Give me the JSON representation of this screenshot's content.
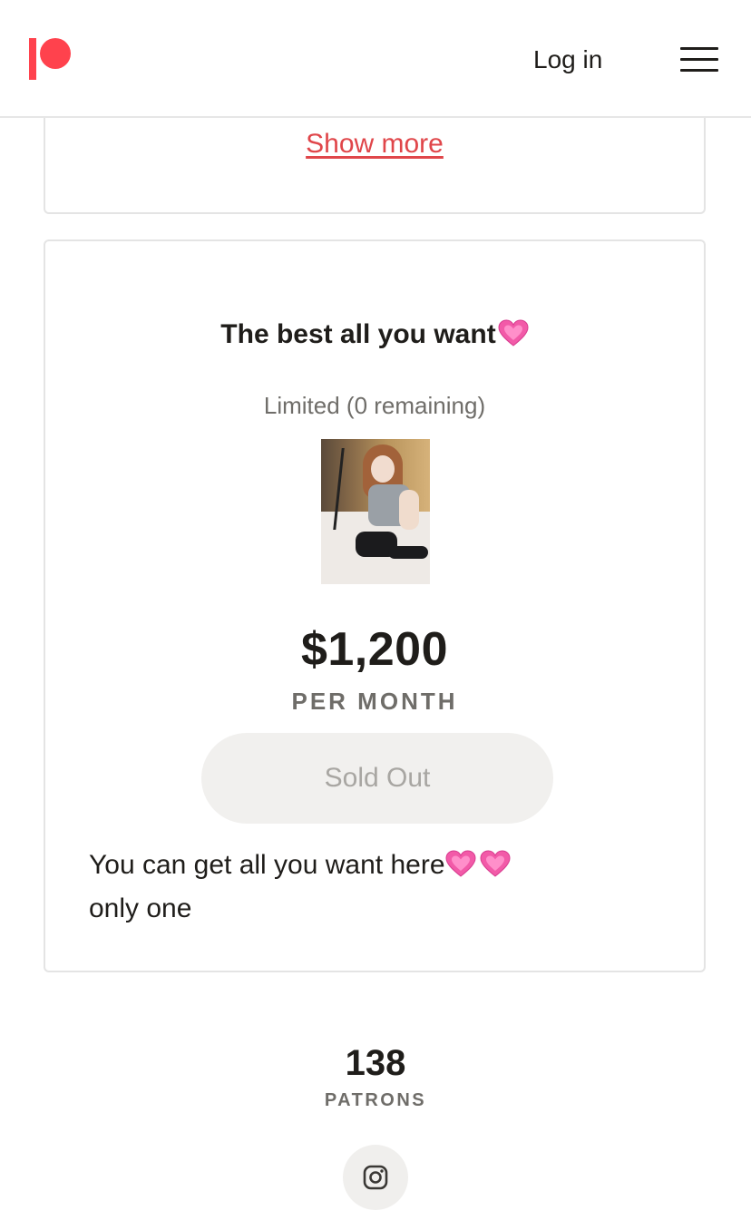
{
  "header": {
    "login_label": "Log in"
  },
  "about_card": {
    "show_more_label": "Show more"
  },
  "tier": {
    "title": "The best all you want",
    "availability": "Limited (0 remaining)",
    "price": "$1,200",
    "period": "PER MONTH",
    "button_label": "Sold Out",
    "description_line1": "You can get all you want here",
    "description_line2": "only one"
  },
  "stats": {
    "patron_count": "138",
    "patron_label": "PATRONS"
  },
  "icons": {
    "logo": "patreon-logo",
    "menu": "hamburger-menu-icon",
    "heart": "growing-heart-emoji",
    "social": "instagram-icon"
  },
  "colors": {
    "brand": "#ff424d",
    "link": "#e0464a",
    "muted_text": "#6f6d69",
    "disabled_button_bg": "#f1f0ee"
  }
}
